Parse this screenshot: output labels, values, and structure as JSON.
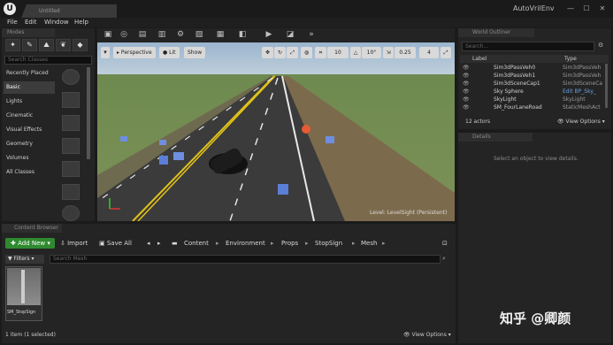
{
  "window": {
    "tab_label": "Untitled",
    "app_title": "AutoVrilEnv",
    "controls": [
      "—",
      "☐",
      "✕"
    ]
  },
  "menu": [
    "File",
    "Edit",
    "Window",
    "Help"
  ],
  "modes": {
    "title": "Modes",
    "search_placeholder": "Search Classes",
    "categories": [
      "Recently Placed",
      "Basic",
      "Lights",
      "Cinematic",
      "Visual Effects",
      "Geometry",
      "Volumes",
      "All Classes"
    ],
    "selected": "Basic"
  },
  "viewport": {
    "perspective": "Perspective",
    "lit": "Lit",
    "show": "Show",
    "grid_snap": "10",
    "rot_snap": "10°",
    "scale_snap": "0.25",
    "cam_speed": "4",
    "level_label": "Level: LevelSight (Persistent)"
  },
  "outliner": {
    "title": "World Outliner",
    "search_placeholder": "Search...",
    "col_label": "Label",
    "col_type": "Type",
    "rows": [
      {
        "name": "Sim3dPassVeh0",
        "type": "Sim3dPassVeh"
      },
      {
        "name": "Sim3dPassVeh1",
        "type": "Sim3dPassVeh"
      },
      {
        "name": "Sim3dSceneCap1",
        "type": "Sim3dSceneCa"
      },
      {
        "name": "Sky Sphere",
        "type": "Edit BP_Sky_"
      },
      {
        "name": "SkyLight",
        "type": "SkyLight"
      },
      {
        "name": "SM_FourLaneRoad",
        "type": "StaticMeshAct"
      }
    ],
    "count": "12 actors",
    "view_options": "View Options"
  },
  "details": {
    "title": "Details",
    "empty_msg": "Select an object to view details."
  },
  "content_browser": {
    "title": "Content Browser",
    "add_new": "Add New",
    "import": "Import",
    "save_all": "Save All",
    "path": [
      "Content",
      "Environment",
      "Props",
      "StopSign",
      "Mesh"
    ],
    "filters": "Filters",
    "search_placeholder": "Search Mesh",
    "asset_name": "SM_StopSign",
    "status": "1 item (1 selected)",
    "view_options": "View Options"
  },
  "watermark": "知乎 @卿颜"
}
